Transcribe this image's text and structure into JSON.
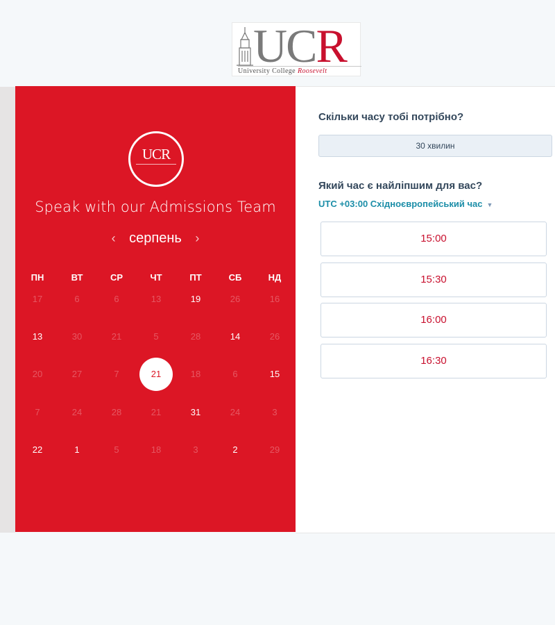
{
  "logo": {
    "uc": "UC",
    "r": "R",
    "tagline_main": "University College",
    "tagline_accent": "Roosevelt"
  },
  "booking": {
    "title": "Speak with our Admissions Team",
    "month": "серпень",
    "prev_icon": "‹",
    "next_icon": "›",
    "weekdays": [
      "ПН",
      "ВТ",
      "СР",
      "ЧТ",
      "ПТ",
      "СБ",
      "НД"
    ],
    "weeks": [
      [
        {
          "d": "17",
          "s": "off"
        },
        {
          "d": "6",
          "s": "off"
        },
        {
          "d": "6",
          "s": "off"
        },
        {
          "d": "13",
          "s": "off"
        },
        {
          "d": "19",
          "s": "on"
        },
        {
          "d": "26",
          "s": "off"
        },
        {
          "d": "16",
          "s": "off"
        }
      ],
      [
        {
          "d": "13",
          "s": "on"
        },
        {
          "d": "30",
          "s": "off"
        },
        {
          "d": "21",
          "s": "off"
        },
        {
          "d": "5",
          "s": "off"
        },
        {
          "d": "28",
          "s": "off"
        },
        {
          "d": "14",
          "s": "on"
        },
        {
          "d": "26",
          "s": "off"
        }
      ],
      [
        {
          "d": "20",
          "s": "off"
        },
        {
          "d": "27",
          "s": "off"
        },
        {
          "d": "7",
          "s": "off"
        },
        {
          "d": "21",
          "s": "sel"
        },
        {
          "d": "18",
          "s": "off"
        },
        {
          "d": "6",
          "s": "off"
        },
        {
          "d": "15",
          "s": "on"
        }
      ],
      [
        {
          "d": "7",
          "s": "off"
        },
        {
          "d": "24",
          "s": "off"
        },
        {
          "d": "28",
          "s": "off"
        },
        {
          "d": "21",
          "s": "off"
        },
        {
          "d": "31",
          "s": "on"
        },
        {
          "d": "24",
          "s": "off"
        },
        {
          "d": "3",
          "s": "off"
        }
      ],
      [
        {
          "d": "22",
          "s": "on"
        },
        {
          "d": "1",
          "s": "on"
        },
        {
          "d": "5",
          "s": "off"
        },
        {
          "d": "18",
          "s": "off"
        },
        {
          "d": "3",
          "s": "off"
        },
        {
          "d": "2",
          "s": "on"
        },
        {
          "d": "29",
          "s": "off"
        }
      ]
    ]
  },
  "side": {
    "duration_question": "Скільки часу тобі потрібно?",
    "duration_value": "30 хвилин",
    "time_question": "Який час є найліпшим для вас?",
    "timezone": "UTC +03:00 Східноєвропейський час",
    "slots": [
      "15:00",
      "15:30",
      "16:00",
      "16:30"
    ]
  },
  "colors": {
    "brand_red": "#dc1625",
    "accent_teal": "#1c8ea8",
    "slot_text": "#c8102e"
  }
}
